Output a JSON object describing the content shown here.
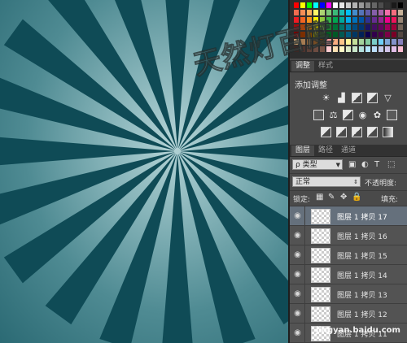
{
  "swatch_colors": [
    "#ff0000",
    "#ffff00",
    "#00ff00",
    "#00ffff",
    "#0000ff",
    "#ff00ff",
    "#ffffff",
    "#e6e6e6",
    "#cccccc",
    "#b3b3b3",
    "#999999",
    "#808080",
    "#666666",
    "#4d4d4d",
    "#333333",
    "#1a1a1a",
    "#000000",
    "#f26c4f",
    "#f68e55",
    "#fbaf5c",
    "#fff467",
    "#acd372",
    "#7cc576",
    "#3bb878",
    "#1abbb4",
    "#00bff3",
    "#438ccb",
    "#5574b9",
    "#605ca8",
    "#855fa8",
    "#a763a8",
    "#f06ea9",
    "#f26d7d",
    "#c7b299",
    "#ed1c24",
    "#f26522",
    "#f7941d",
    "#fff200",
    "#8dc63f",
    "#39b54a",
    "#00a651",
    "#00a99d",
    "#00aeef",
    "#0072bc",
    "#0054a6",
    "#2e3192",
    "#662d91",
    "#92278f",
    "#ec008c",
    "#ed145b",
    "#998675",
    "#9e0b0f",
    "#a0410d",
    "#a3620a",
    "#aba000",
    "#598527",
    "#1a7b30",
    "#007236",
    "#00746b",
    "#0076a3",
    "#004b80",
    "#003471",
    "#1b1464",
    "#440e62",
    "#630460",
    "#9e005d",
    "#9e0039",
    "#736357",
    "#790000",
    "#7b2e00",
    "#7d4900",
    "#827b00",
    "#406618",
    "#005e20",
    "#005826",
    "#005952",
    "#005b7f",
    "#003663",
    "#002157",
    "#0d004c",
    "#32004b",
    "#4b0049",
    "#7b0046",
    "#7a0026",
    "#534741",
    "#c69c6d",
    "#a67c52",
    "#8c6239",
    "#754c24",
    "#603913",
    "#f5989d",
    "#f9ad81",
    "#fdc68a",
    "#fff79a",
    "#c4df9b",
    "#a3d39c",
    "#82ca9d",
    "#7bcdc8",
    "#6ecff6",
    "#7da7d9",
    "#8393ca",
    "#8781bd",
    "#3e2723",
    "#4e342e",
    "#5d4037",
    "#6d4c41",
    "#795548",
    "#ffcdd2",
    "#ffe0b2",
    "#fff9c4",
    "#dcedc8",
    "#c8e6c9",
    "#b2dfdb",
    "#b3e5fc",
    "#bbdefb",
    "#c5cae9",
    "#d1c4e9",
    "#e1bee7",
    "#f8bbd0"
  ],
  "adjust_panel": {
    "tab_adjust": "调整",
    "tab_styles": "样式",
    "title": "添加调整"
  },
  "layers_panel": {
    "tab_layers": "图层",
    "tab_paths": "路径",
    "tab_channels": "通道",
    "filter_label": "ρ 类型",
    "blend_mode": "正常",
    "opacity_label": "不透明度:",
    "lock_label": "锁定:",
    "fill_label": "填充:",
    "layers": [
      {
        "name": "图层 1 拷贝 17",
        "selected": true
      },
      {
        "name": "图层 1 拷贝 16",
        "selected": false
      },
      {
        "name": "图层 1 拷贝 15",
        "selected": false
      },
      {
        "name": "图层 1 拷贝 14",
        "selected": false
      },
      {
        "name": "图层 1 拷贝 13",
        "selected": false
      },
      {
        "name": "图层 1 拷贝 12",
        "selected": false
      },
      {
        "name": "图层 1 拷贝 11",
        "selected": false
      }
    ]
  },
  "ray_color": "#0f4b56",
  "watermark_text": "天然灯百度",
  "watermark_url": "jingyan.baidu.com"
}
